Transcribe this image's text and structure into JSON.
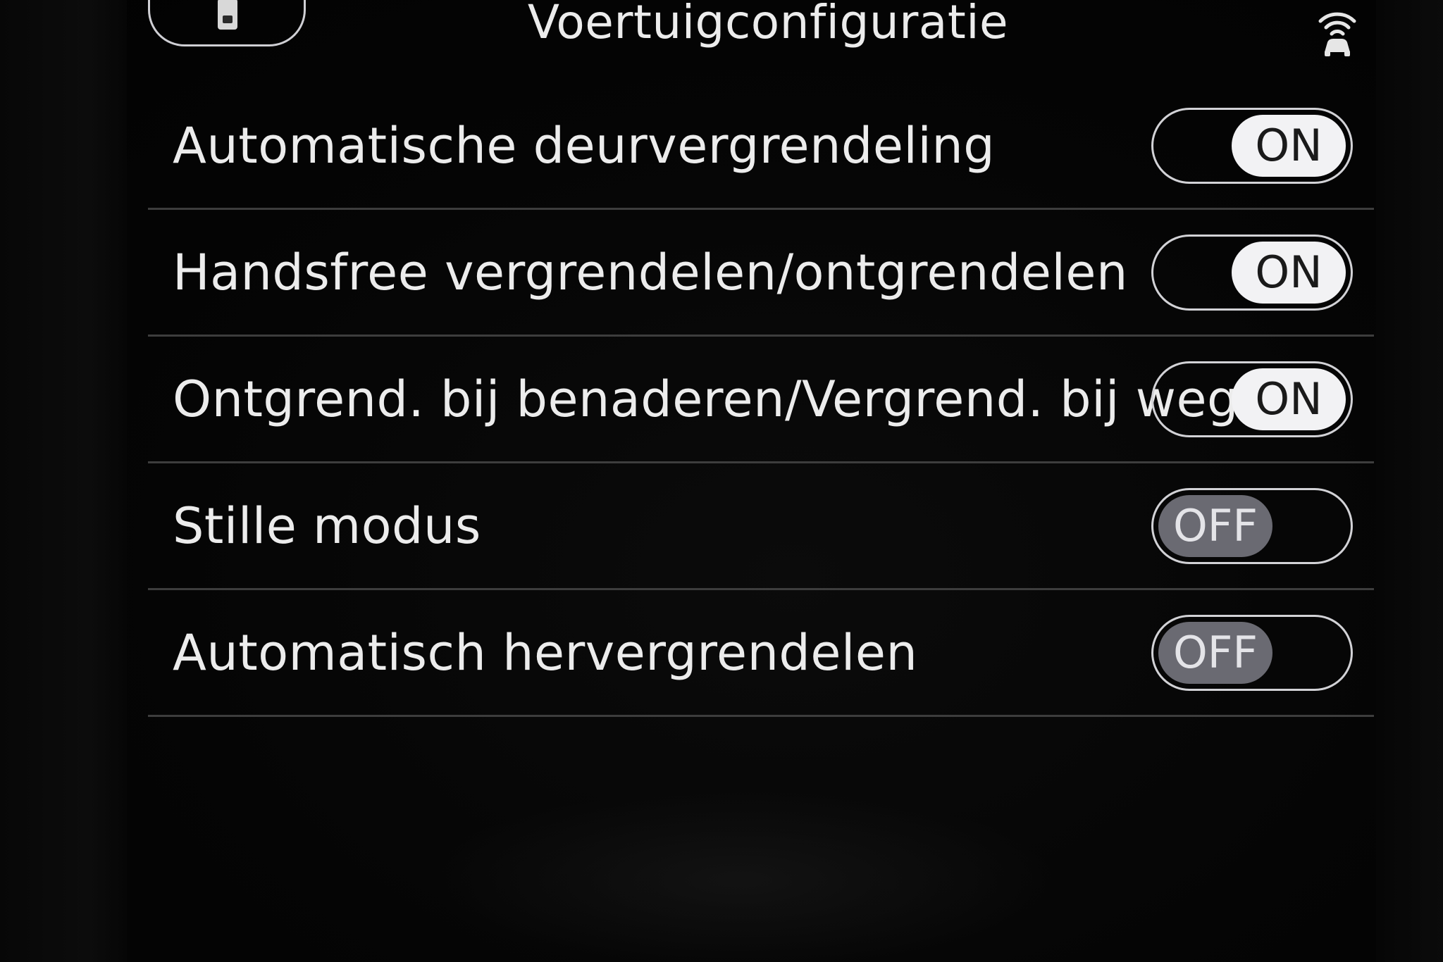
{
  "header": {
    "title": "Voertuigconfiguratie",
    "left_icon": "phone-icon",
    "right_icon": "car-signal-icon"
  },
  "settings": [
    {
      "label": "Automatische deurvergrendeling",
      "state": "ON"
    },
    {
      "label": "Handsfree vergrendelen/ontgrendelen",
      "state": "ON"
    },
    {
      "label": "Ontgrend. bij benaderen/Vergrend. bij weglo...",
      "state": "ON"
    },
    {
      "label": "Stille modus",
      "state": "OFF"
    },
    {
      "label": "Automatisch hervergrendelen",
      "state": "OFF"
    }
  ],
  "colors": {
    "background": "#040404",
    "text": "#ececec",
    "toggle_on_thumb": "#f2f2f4",
    "toggle_off_thumb": "#6a6a72"
  }
}
